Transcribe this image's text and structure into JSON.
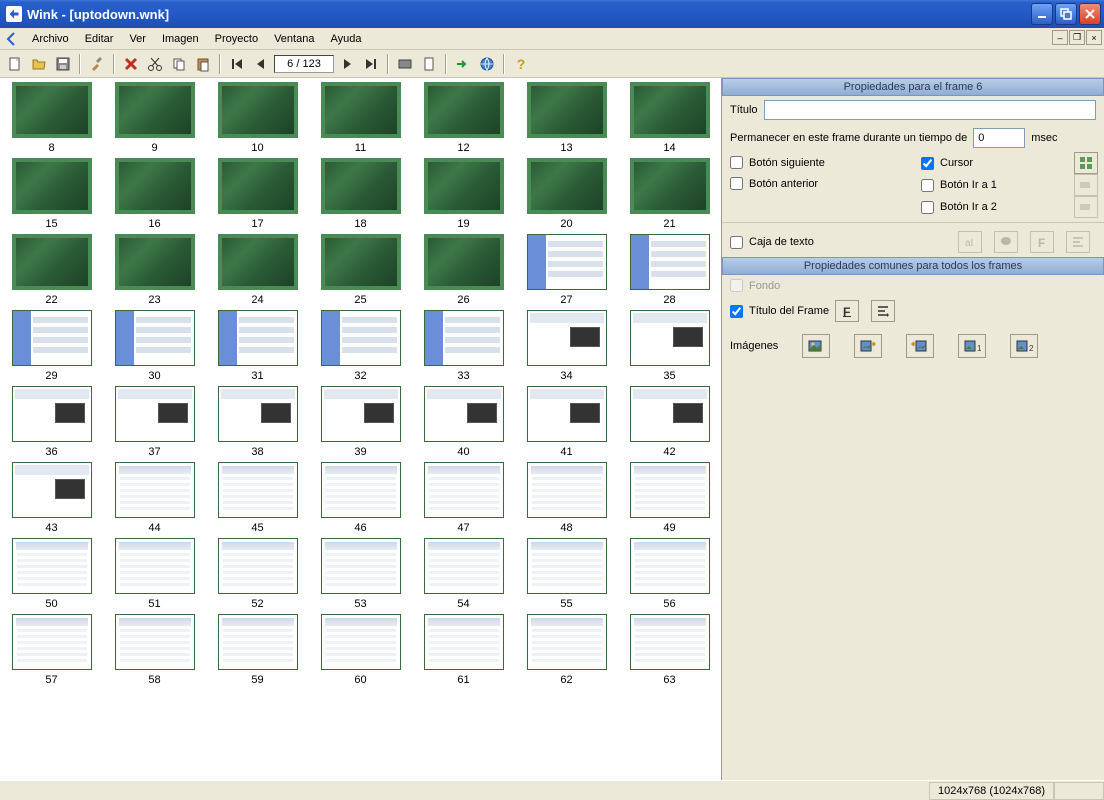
{
  "window": {
    "title": "Wink - [uptodown.wnk]"
  },
  "menu": {
    "items": [
      "Archivo",
      "Editar",
      "Ver",
      "Imagen",
      "Proyecto",
      "Ventana",
      "Ayuda"
    ]
  },
  "toolbar": {
    "frame_counter": "6 / 123"
  },
  "thumbnails": {
    "frames": [
      {
        "n": 8,
        "t": "green"
      },
      {
        "n": 9,
        "t": "green"
      },
      {
        "n": 10,
        "t": "green"
      },
      {
        "n": 11,
        "t": "green"
      },
      {
        "n": 12,
        "t": "green"
      },
      {
        "n": 13,
        "t": "green"
      },
      {
        "n": 14,
        "t": "green"
      },
      {
        "n": 15,
        "t": "green"
      },
      {
        "n": 16,
        "t": "green"
      },
      {
        "n": 17,
        "t": "green"
      },
      {
        "n": 18,
        "t": "green"
      },
      {
        "n": 19,
        "t": "green"
      },
      {
        "n": 20,
        "t": "green"
      },
      {
        "n": 21,
        "t": "green"
      },
      {
        "n": 22,
        "t": "green"
      },
      {
        "n": 23,
        "t": "green"
      },
      {
        "n": 24,
        "t": "green"
      },
      {
        "n": 25,
        "t": "green"
      },
      {
        "n": 26,
        "t": "green"
      },
      {
        "n": 27,
        "t": "blue"
      },
      {
        "n": 28,
        "t": "blue"
      },
      {
        "n": 29,
        "t": "blue"
      },
      {
        "n": 30,
        "t": "blue"
      },
      {
        "n": 31,
        "t": "blue"
      },
      {
        "n": 32,
        "t": "blue"
      },
      {
        "n": 33,
        "t": "blue"
      },
      {
        "n": 34,
        "t": "snap"
      },
      {
        "n": 35,
        "t": "snap"
      },
      {
        "n": 36,
        "t": "snap"
      },
      {
        "n": 37,
        "t": "snap"
      },
      {
        "n": 38,
        "t": "snap"
      },
      {
        "n": 39,
        "t": "snap"
      },
      {
        "n": 40,
        "t": "snap"
      },
      {
        "n": 41,
        "t": "snap"
      },
      {
        "n": 42,
        "t": "snap"
      },
      {
        "n": 43,
        "t": "snap"
      },
      {
        "n": 44,
        "t": "page"
      },
      {
        "n": 45,
        "t": "page"
      },
      {
        "n": 46,
        "t": "page"
      },
      {
        "n": 47,
        "t": "page"
      },
      {
        "n": 48,
        "t": "page"
      },
      {
        "n": 49,
        "t": "page"
      },
      {
        "n": 50,
        "t": "page"
      },
      {
        "n": 51,
        "t": "page"
      },
      {
        "n": 52,
        "t": "page"
      },
      {
        "n": 53,
        "t": "page"
      },
      {
        "n": 54,
        "t": "page"
      },
      {
        "n": 55,
        "t": "page"
      },
      {
        "n": 56,
        "t": "page"
      },
      {
        "n": 57,
        "t": "page"
      },
      {
        "n": 58,
        "t": "page"
      },
      {
        "n": 59,
        "t": "page"
      },
      {
        "n": 60,
        "t": "page"
      },
      {
        "n": 61,
        "t": "page"
      },
      {
        "n": 62,
        "t": "page"
      },
      {
        "n": 63,
        "t": "page"
      }
    ]
  },
  "properties": {
    "header1": "Propiedades para el frame 6",
    "title_label": "Título",
    "title_value": "",
    "stay_label": "Permanecer en este frame durante un tiempo de",
    "stay_value": "0",
    "stay_unit": "msec",
    "btn_next": "Botón siguiente",
    "btn_prev": "Botón anterior",
    "cursor": "Cursor",
    "goto1": "Botón Ir a 1",
    "goto2": "Botón Ir a 2",
    "textbox": "Caja de texto",
    "header2": "Propiedades comunes para todos los frames",
    "background": "Fondo",
    "frame_title": "Título del Frame",
    "images": "Imágenes",
    "cursor_checked": true,
    "frame_title_checked": true
  },
  "statusbar": {
    "dim": "1024x768 (1024x768)"
  }
}
